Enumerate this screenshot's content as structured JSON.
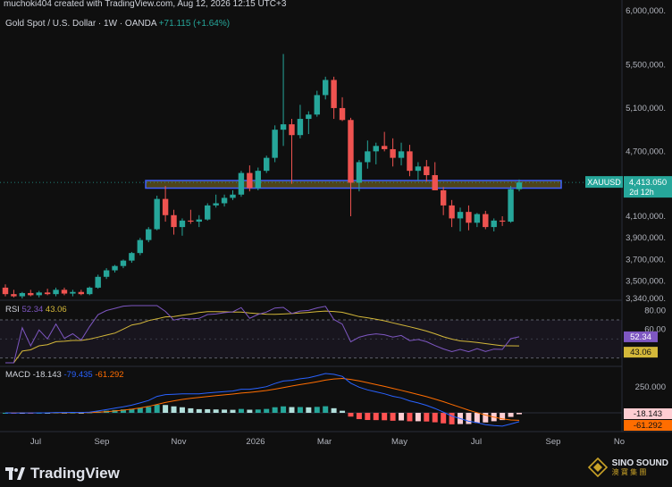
{
  "header": {
    "byline": "muchoki404 created with TradingView.com, Aug 12, 2026 12:15 UTC+3",
    "symbol_desc": "Gold Spot / U.S. Dollar · 1W · OANDA",
    "change": "+71.115 (+1.64%)"
  },
  "branding": {
    "tradingview": "TradingView",
    "watermark_line1": "SINO SOUND",
    "watermark_line2": "澳 寶 集 團"
  },
  "price_scale": {
    "labels": [
      "6,000,000.",
      "5,500,000.",
      "5,100,000.",
      "4,700,000.",
      "4,100,000.",
      "3,900,000.",
      "3,700,000.",
      "3,500,000.",
      "3,340,000."
    ]
  },
  "last_price": {
    "ticker": "XAUUSD",
    "value": "4,413.050",
    "countdown": "2d 12h"
  },
  "rsi": {
    "label": "RSI",
    "value": "52.34",
    "ma_value": "43.06",
    "axis": [
      "80.00",
      "60.00"
    ]
  },
  "macd": {
    "label": "MACD",
    "macd": "-18.143",
    "signal": "-79.435",
    "hist": "-61.292",
    "axis_top": "250.000",
    "badge_top": "-18.143",
    "badge_bottom": "-61.292"
  },
  "x_axis": [
    "Jul",
    "Sep",
    "Nov",
    "2026",
    "Mar",
    "May",
    "Jul",
    "Sep",
    "No"
  ],
  "colors": {
    "up": "#26a69a",
    "down": "#ef5350",
    "rsi_line": "#7e57c2",
    "rsi_ma": "#d4b83a",
    "macd_line": "#2962ff",
    "signal_line": "#ff6d00",
    "zone_border": "#3f5fff",
    "zone_fill": "#5a4e1c"
  },
  "chart_data": {
    "type": "candlestick",
    "title": "Gold Spot / U.S. Dollar · 1W · OANDA",
    "ylim": [
      3340,
      6000
    ],
    "resistance_zone": [
      4360,
      4430
    ],
    "candles": [
      {
        "o": 3440,
        "h": 3470,
        "l": 3360,
        "c": 3380
      },
      {
        "o": 3380,
        "h": 3420,
        "l": 3350,
        "c": 3360
      },
      {
        "o": 3360,
        "h": 3400,
        "l": 3340,
        "c": 3390
      },
      {
        "o": 3390,
        "h": 3420,
        "l": 3360,
        "c": 3370
      },
      {
        "o": 3370,
        "h": 3410,
        "l": 3350,
        "c": 3395
      },
      {
        "o": 3395,
        "h": 3430,
        "l": 3370,
        "c": 3380
      },
      {
        "o": 3380,
        "h": 3440,
        "l": 3360,
        "c": 3420
      },
      {
        "o": 3420,
        "h": 3440,
        "l": 3370,
        "c": 3385
      },
      {
        "o": 3385,
        "h": 3420,
        "l": 3360,
        "c": 3400
      },
      {
        "o": 3400,
        "h": 3420,
        "l": 3370,
        "c": 3380
      },
      {
        "o": 3380,
        "h": 3450,
        "l": 3370,
        "c": 3440
      },
      {
        "o": 3440,
        "h": 3560,
        "l": 3430,
        "c": 3540
      },
      {
        "o": 3540,
        "h": 3620,
        "l": 3520,
        "c": 3600
      },
      {
        "o": 3600,
        "h": 3650,
        "l": 3580,
        "c": 3640
      },
      {
        "o": 3640,
        "h": 3700,
        "l": 3620,
        "c": 3690
      },
      {
        "o": 3690,
        "h": 3770,
        "l": 3670,
        "c": 3760
      },
      {
        "o": 3760,
        "h": 3900,
        "l": 3740,
        "c": 3880
      },
      {
        "o": 3880,
        "h": 4000,
        "l": 3860,
        "c": 3980
      },
      {
        "o": 3980,
        "h": 4290,
        "l": 3970,
        "c": 4260
      },
      {
        "o": 4260,
        "h": 4380,
        "l": 4050,
        "c": 4110
      },
      {
        "o": 4110,
        "h": 4160,
        "l": 3930,
        "c": 4000
      },
      {
        "o": 4000,
        "h": 4080,
        "l": 3920,
        "c": 4060
      },
      {
        "o": 4060,
        "h": 4160,
        "l": 4030,
        "c": 4050
      },
      {
        "o": 4050,
        "h": 4110,
        "l": 4000,
        "c": 4070
      },
      {
        "o": 4070,
        "h": 4220,
        "l": 4060,
        "c": 4200
      },
      {
        "o": 4200,
        "h": 4300,
        "l": 4180,
        "c": 4220
      },
      {
        "o": 4220,
        "h": 4300,
        "l": 4190,
        "c": 4270
      },
      {
        "o": 4270,
        "h": 4340,
        "l": 4250,
        "c": 4300
      },
      {
        "o": 4300,
        "h": 4520,
        "l": 4280,
        "c": 4500
      },
      {
        "o": 4500,
        "h": 4570,
        "l": 4330,
        "c": 4360
      },
      {
        "o": 4360,
        "h": 4550,
        "l": 4340,
        "c": 4520
      },
      {
        "o": 4520,
        "h": 4660,
        "l": 4500,
        "c": 4640
      },
      {
        "o": 4640,
        "h": 4940,
        "l": 4600,
        "c": 4900
      },
      {
        "o": 4900,
        "h": 5600,
        "l": 4750,
        "c": 4950
      },
      {
        "o": 4950,
        "h": 5000,
        "l": 4400,
        "c": 4850
      },
      {
        "o": 4850,
        "h": 5130,
        "l": 4820,
        "c": 5000
      },
      {
        "o": 5000,
        "h": 5070,
        "l": 4860,
        "c": 5040
      },
      {
        "o": 5040,
        "h": 5260,
        "l": 5020,
        "c": 5220
      },
      {
        "o": 5220,
        "h": 5390,
        "l": 5180,
        "c": 5360
      },
      {
        "o": 5360,
        "h": 5390,
        "l": 5000,
        "c": 5100
      },
      {
        "o": 5100,
        "h": 5200,
        "l": 4980,
        "c": 4990
      },
      {
        "o": 4990,
        "h": 5010,
        "l": 4100,
        "c": 4410
      },
      {
        "o": 4410,
        "h": 4620,
        "l": 4330,
        "c": 4600
      },
      {
        "o": 4600,
        "h": 4800,
        "l": 4540,
        "c": 4700
      },
      {
        "o": 4700,
        "h": 4780,
        "l": 4580,
        "c": 4750
      },
      {
        "o": 4750,
        "h": 4880,
        "l": 4700,
        "c": 4720
      },
      {
        "o": 4720,
        "h": 4820,
        "l": 4560,
        "c": 4640
      },
      {
        "o": 4640,
        "h": 4780,
        "l": 4570,
        "c": 4700
      },
      {
        "o": 4700,
        "h": 4760,
        "l": 4470,
        "c": 4520
      },
      {
        "o": 4520,
        "h": 4600,
        "l": 4430,
        "c": 4560
      },
      {
        "o": 4560,
        "h": 4620,
        "l": 4420,
        "c": 4480
      },
      {
        "o": 4480,
        "h": 4600,
        "l": 4370,
        "c": 4340
      },
      {
        "o": 4340,
        "h": 4370,
        "l": 4110,
        "c": 4200
      },
      {
        "o": 4200,
        "h": 4250,
        "l": 4000,
        "c": 4080
      },
      {
        "o": 4080,
        "h": 4180,
        "l": 3960,
        "c": 4140
      },
      {
        "o": 4140,
        "h": 4200,
        "l": 3970,
        "c": 4040
      },
      {
        "o": 4040,
        "h": 4130,
        "l": 4000,
        "c": 4120
      },
      {
        "o": 4120,
        "h": 4150,
        "l": 3980,
        "c": 4000
      },
      {
        "o": 4000,
        "h": 4080,
        "l": 3960,
        "c": 4060
      },
      {
        "o": 4060,
        "h": 4100,
        "l": 4010,
        "c": 4050
      },
      {
        "o": 4050,
        "h": 4380,
        "l": 4040,
        "c": 4350
      },
      {
        "o": 4350,
        "h": 4440,
        "l": 4330,
        "c": 4413
      }
    ]
  }
}
